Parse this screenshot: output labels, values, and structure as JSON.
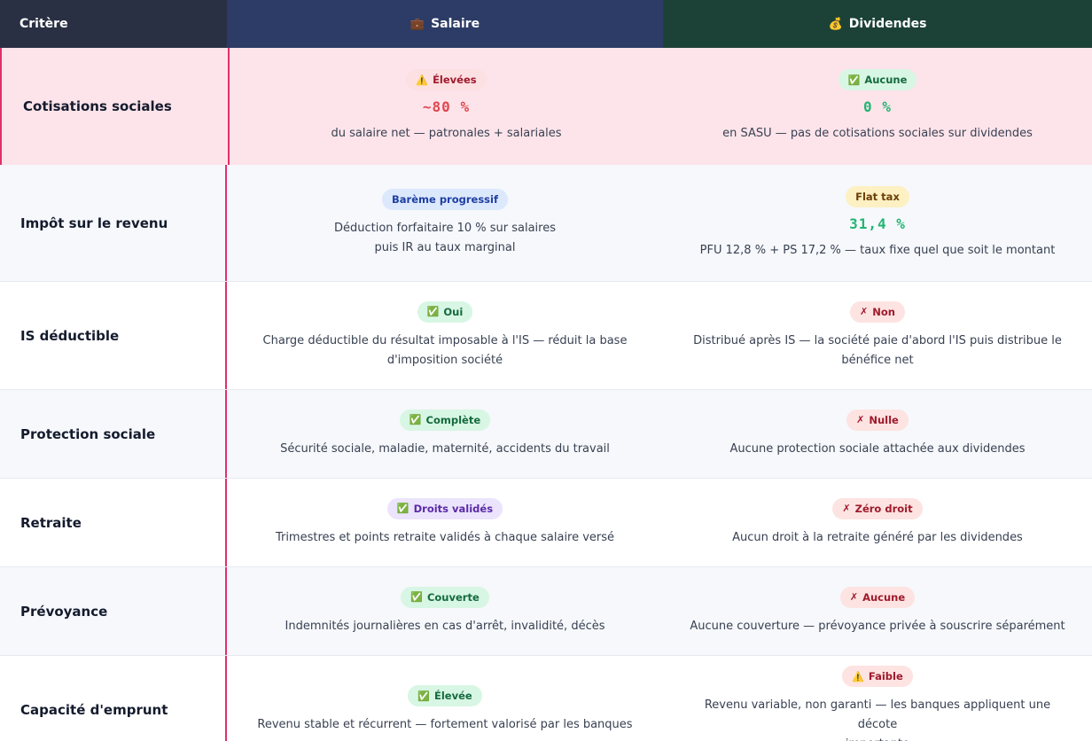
{
  "header": {
    "criterion_label": "Critère",
    "salary_label": "Salaire",
    "salary_icon": "briefcase-icon",
    "dividends_label": "Dividendes",
    "dividends_icon": "money-bag-icon"
  },
  "rows": [
    {
      "criterion": "Cotisations sociales",
      "salary": {
        "badge": "Élevées",
        "badge_icon": "warning-icon",
        "value": "~80 %",
        "desc": "du salaire net — patronales + salariales"
      },
      "dividends": {
        "badge": "Aucune",
        "badge_icon": "check-icon",
        "value": "0 %",
        "desc": "en SASU — pas de cotisations sociales sur dividendes"
      }
    },
    {
      "criterion": "Impôt sur le revenu",
      "salary": {
        "badge": "Barème progressif",
        "desc_line1": "Déduction forfaitaire 10 % sur salaires",
        "desc_line2": "puis IR au taux marginal"
      },
      "dividends": {
        "badge": "Flat tax",
        "value": "31,4 %",
        "desc": "PFU 12,8 % + PS 17,2 % — taux fixe quel que soit le montant"
      }
    },
    {
      "criterion": "IS déductible",
      "salary": {
        "badge": "Oui",
        "badge_icon": "check-icon",
        "desc_line1": "Charge déductible du résultat imposable à l'IS — réduit la base",
        "desc_line2": "d'imposition société"
      },
      "dividends": {
        "badge": "Non",
        "badge_icon": "cross-icon",
        "desc_line1": "Distribué après IS — la société paie d'abord l'IS puis distribue le",
        "desc_line2": "bénéfice net"
      }
    },
    {
      "criterion": "Protection sociale",
      "salary": {
        "badge": "Complète",
        "badge_icon": "check-icon",
        "desc": "Sécurité sociale, maladie, maternité, accidents du travail"
      },
      "dividends": {
        "badge": "Nulle",
        "badge_icon": "cross-icon",
        "desc": "Aucune protection sociale attachée aux dividendes"
      }
    },
    {
      "criterion": "Retraite",
      "salary": {
        "badge": "Droits validés",
        "badge_icon": "check-icon",
        "desc": "Trimestres et points retraite validés à chaque salaire versé"
      },
      "dividends": {
        "badge": "Zéro droit",
        "badge_icon": "cross-icon",
        "desc": "Aucun droit à la retraite généré par les dividendes"
      }
    },
    {
      "criterion": "Prévoyance",
      "salary": {
        "badge": "Couverte",
        "badge_icon": "check-icon",
        "desc": "Indemnités journalières en cas d'arrêt, invalidité, décès"
      },
      "dividends": {
        "badge": "Aucune",
        "badge_icon": "cross-icon",
        "desc": "Aucune couverture — prévoyance privée à souscrire séparément"
      }
    },
    {
      "criterion": "Capacité d'emprunt",
      "salary": {
        "badge": "Élevée",
        "badge_icon": "check-icon",
        "desc": "Revenu stable et récurrent — fortement valorisé par les banques"
      },
      "dividends": {
        "badge": "Faible",
        "badge_icon": "warning-icon",
        "desc_line1": "Revenu variable, non garanti — les banques appliquent une décote",
        "desc_line2": "importante"
      }
    }
  ],
  "colors": {
    "accent": "#e0306b",
    "header_criterion": "#2a3044",
    "header_salary": "#2c3c66",
    "header_dividends": "#1c4238",
    "negative_value": "#e0474f",
    "positive_value": "#22b573"
  }
}
